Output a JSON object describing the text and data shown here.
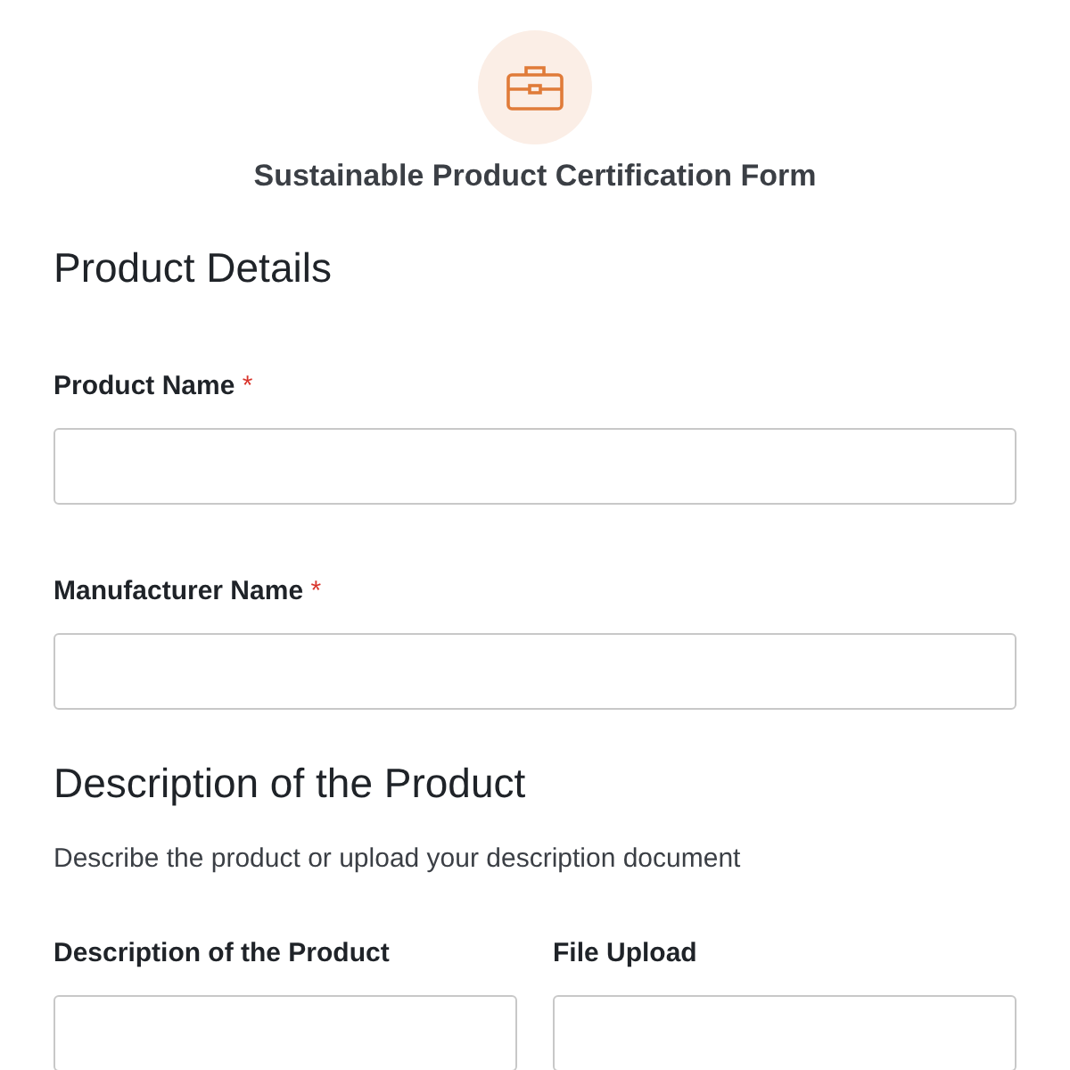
{
  "form": {
    "title": "Sustainable Product Certification Form"
  },
  "sections": [
    {
      "heading": "Product Details",
      "fields": [
        {
          "label": "Product Name",
          "required": true,
          "required_mark": "*"
        },
        {
          "label": "Manufacturer Name",
          "required": true,
          "required_mark": "*"
        }
      ]
    },
    {
      "heading": "Description of the Product",
      "description": "Describe the product or upload your description document",
      "columns": [
        {
          "label": "Description of the Product"
        },
        {
          "label": "File Upload"
        }
      ]
    }
  ]
}
